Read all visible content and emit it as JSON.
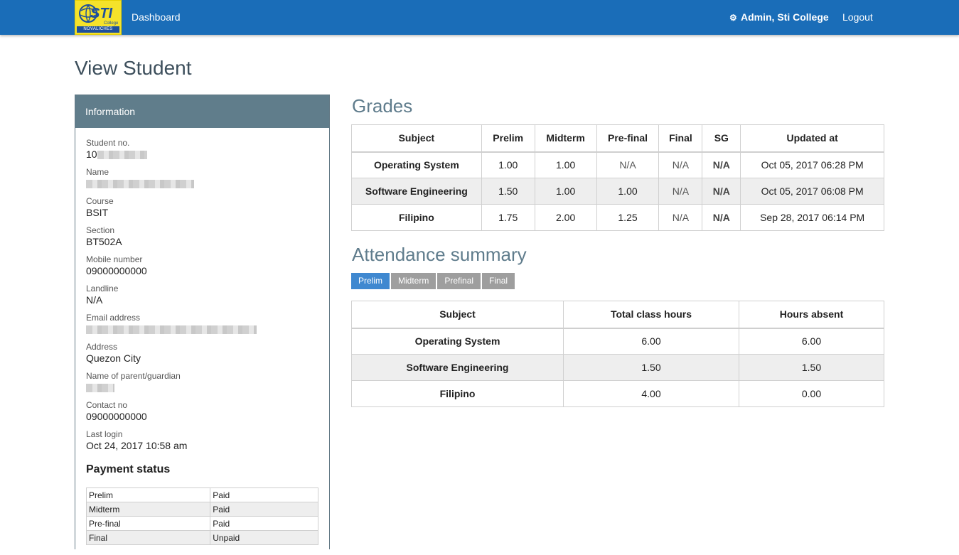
{
  "navbar": {
    "logo": {
      "text": "STI",
      "sub_text": "College",
      "location_text": "NOVALICHES"
    },
    "dashboard_label": "Dashboard",
    "user_label": "Admin, Sti College",
    "user_icon": "gear-icon",
    "logout_label": "Logout"
  },
  "page_title": "View Student",
  "info": {
    "header": "Information",
    "fields": [
      {
        "label": "Student no.",
        "value": "10",
        "redacted": true
      },
      {
        "label": "Name",
        "value": "",
        "redacted": true
      },
      {
        "label": "Course",
        "value": "BSIT"
      },
      {
        "label": "Section",
        "value": "BT502A"
      },
      {
        "label": "Mobile number",
        "value": "09000000000"
      },
      {
        "label": "Landline",
        "value": "N/A"
      },
      {
        "label": "Email address",
        "value": "",
        "redacted": true
      },
      {
        "label": "Address",
        "value": "Quezon City"
      },
      {
        "label": "Name of parent/guardian",
        "value": "",
        "redacted": true
      },
      {
        "label": "Contact no",
        "value": "09000000000"
      },
      {
        "label": "Last login",
        "value": "Oct 24, 2017 10:58 am"
      }
    ],
    "payment_title": "Payment status",
    "payments": [
      {
        "term": "Prelim",
        "status": "Paid"
      },
      {
        "term": "Midterm",
        "status": "Paid"
      },
      {
        "term": "Pre-final",
        "status": "Paid"
      },
      {
        "term": "Final",
        "status": "Unpaid"
      }
    ]
  },
  "grades": {
    "title": "Grades",
    "columns": [
      "Subject",
      "Prelim",
      "Midterm",
      "Pre-final",
      "Final",
      "SG",
      "Updated at"
    ],
    "rows": [
      [
        "Operating System",
        "1.00",
        "1.00",
        "N/A",
        "N/A",
        "N/A",
        "Oct 05, 2017 06:28 PM"
      ],
      [
        "Software Engineering",
        "1.50",
        "1.00",
        "1.00",
        "N/A",
        "N/A",
        "Oct 05, 2017 06:08 PM"
      ],
      [
        "Filipino",
        "1.75",
        "2.00",
        "1.25",
        "N/A",
        "N/A",
        "Sep 28, 2017 06:14 PM"
      ]
    ]
  },
  "attendance": {
    "title": "Attendance summary",
    "tabs": [
      {
        "label": "Prelim",
        "active": true
      },
      {
        "label": "Midterm",
        "active": false
      },
      {
        "label": "Prefinal",
        "active": false
      },
      {
        "label": "Final",
        "active": false
      }
    ],
    "columns": [
      "Subject",
      "Total class hours",
      "Hours absent"
    ],
    "rows": [
      [
        "Operating System",
        "6.00",
        "6.00"
      ],
      [
        "Software Engineering",
        "1.50",
        "1.50"
      ],
      [
        "Filipino",
        "4.00",
        "0.00"
      ]
    ]
  },
  "colors": {
    "navbar": "#1a6db8",
    "panel_header": "#607d8b",
    "section_title": "#5f7c8c",
    "tab_active": "#3f88d0",
    "tab_inactive": "#9e9e9e"
  }
}
